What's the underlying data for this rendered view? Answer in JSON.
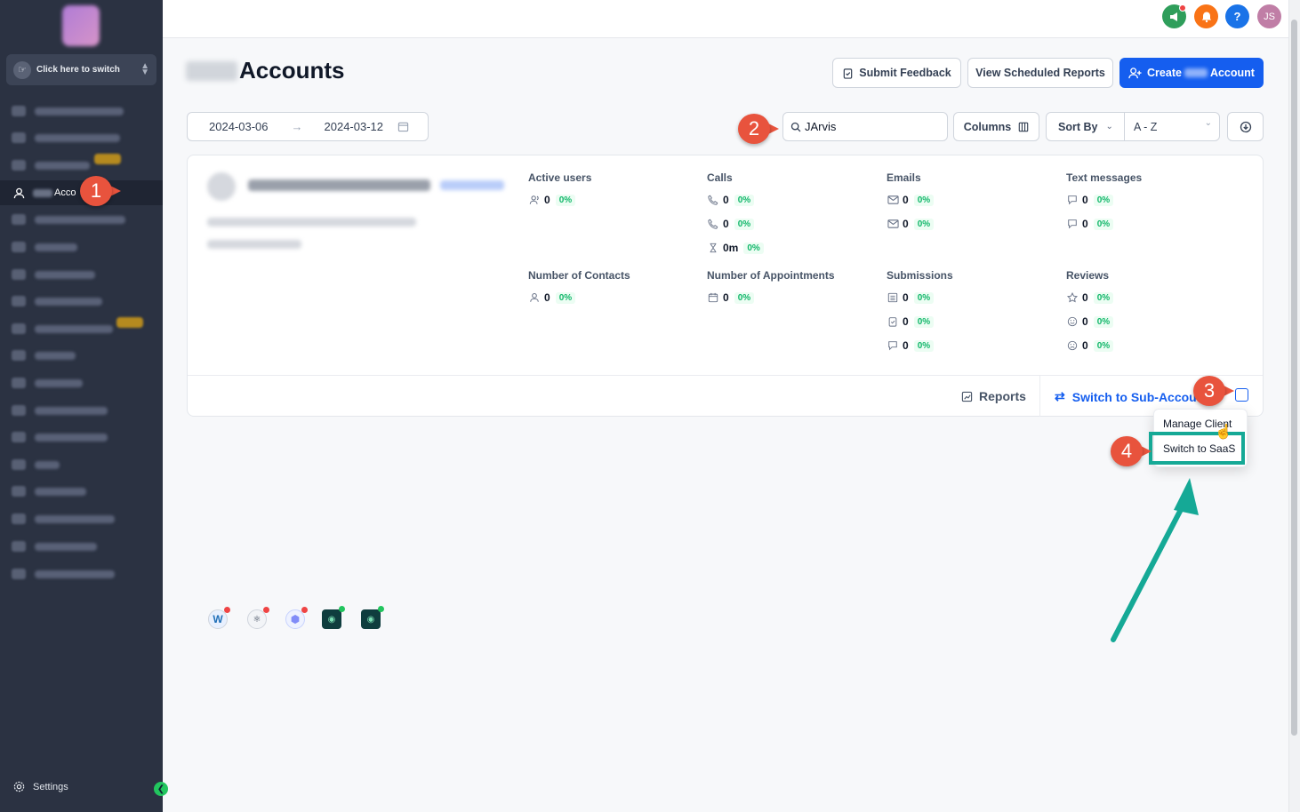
{
  "sidebar": {
    "switcher_label": "Click here to switch",
    "active_item_label": "Acco",
    "settings_label": "Settings",
    "collapse_icon": "chevron-left-icon"
  },
  "topbar": {
    "icons": [
      "megaphone-icon",
      "bell-icon",
      "help-icon"
    ],
    "avatar_initials": "JS",
    "colors": {
      "megaphone": "#2f9e5b",
      "bell": "#f97316",
      "help": "#1a73e8",
      "avatar": "#c07ea6"
    }
  },
  "header": {
    "title": "Accounts",
    "submit_feedback": "Submit Feedback",
    "view_reports": "View Scheduled Reports",
    "create_prefix": "Create",
    "create_suffix": "Account"
  },
  "filters": {
    "date_from": "2024-03-06",
    "date_to": "2024-03-12",
    "search_value": "JArvis",
    "columns_label": "Columns",
    "sort_by_label": "Sort By",
    "sort_value": "A - Z"
  },
  "card": {
    "metrics": {
      "active_users": {
        "label": "Active users",
        "values": [
          {
            "value": "0",
            "pct": "0%"
          }
        ]
      },
      "calls": {
        "label": "Calls",
        "values": [
          {
            "value": "0",
            "pct": "0%"
          },
          {
            "value": "0",
            "pct": "0%"
          },
          {
            "value": "0m",
            "pct": "0%"
          }
        ]
      },
      "emails": {
        "label": "Emails",
        "values": [
          {
            "value": "0",
            "pct": "0%"
          },
          {
            "value": "0",
            "pct": "0%"
          }
        ]
      },
      "text_messages": {
        "label": "Text messages",
        "values": [
          {
            "value": "0",
            "pct": "0%"
          },
          {
            "value": "0",
            "pct": "0%"
          }
        ]
      },
      "contacts": {
        "label": "Number of Contacts",
        "values": [
          {
            "value": "0",
            "pct": "0%"
          }
        ]
      },
      "appointments": {
        "label": "Number of Appointments",
        "values": [
          {
            "value": "0",
            "pct": "0%"
          }
        ]
      },
      "submissions": {
        "label": "Submissions",
        "values": [
          {
            "value": "0",
            "pct": "0%"
          },
          {
            "value": "0",
            "pct": "0%"
          },
          {
            "value": "0",
            "pct": "0%"
          }
        ]
      },
      "reviews": {
        "label": "Reviews",
        "values": [
          {
            "value": "0",
            "pct": "0%"
          },
          {
            "value": "0",
            "pct": "0%"
          },
          {
            "value": "0",
            "pct": "0%"
          }
        ]
      }
    },
    "footer": {
      "reports_label": "Reports",
      "switch_label": "Switch to Sub-Accou"
    }
  },
  "dropdown": {
    "items": [
      "Manage Client",
      "Switch to SaaS"
    ]
  },
  "annotations": [
    "1",
    "2",
    "3",
    "4"
  ],
  "accent": {
    "teal": "#15a996",
    "marker": "#e8533d",
    "primary": "#155eef"
  }
}
